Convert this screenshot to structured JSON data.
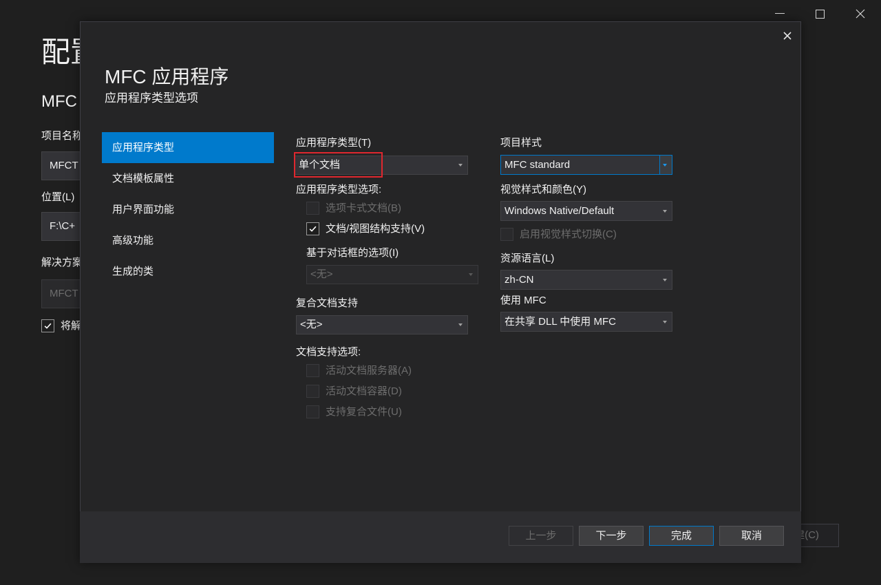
{
  "colors": {
    "window_bg": "#1f1f1f",
    "dialog_bg": "#252526",
    "footer_bg": "#2d2d30",
    "accent": "#007acc",
    "text": "#f1f1f1",
    "text_disabled": "#6d6d6d",
    "highlight": "#e0272e",
    "control_bg": "#333337",
    "control_border": "#434346",
    "disabled_bg": "#2a2a2c",
    "disabled_border": "#3a3a3d",
    "button_bg": "#3f3f41",
    "button_border": "#555558"
  },
  "icons": {
    "window_minimize": "minimize-icon",
    "window_maximize": "maximize-icon",
    "window_close": "close-icon",
    "dialog_close": "close-icon",
    "dropdown": "chevron-down-icon",
    "checkbox_checked": "checkmark-icon"
  },
  "window": {
    "title": "配置",
    "subtitle": "MFC",
    "project_name": {
      "label": "项目名称",
      "value": "MFCT"
    },
    "location": {
      "label": "位置(L)",
      "value": "F:\\C+"
    },
    "solution": {
      "label": "解决方案",
      "value": "MFCT",
      "disabled": true
    },
    "place_in_same_dir": {
      "label": "将解",
      "checked": true,
      "disabled": false
    },
    "create_button": {
      "label": "建(C)",
      "disabled": true
    }
  },
  "dialog": {
    "title": "MFC 应用程序",
    "subtitle": "应用程序类型选项",
    "nav": {
      "selected": 0,
      "items": [
        "应用程序类型",
        "文档模板属性",
        "用户界面功能",
        "高级功能",
        "生成的类"
      ]
    },
    "form": {
      "app_type": {
        "label": "应用程序类型(T)",
        "value": "单个文档",
        "highlighted": true
      },
      "app_type_options": {
        "label": "应用程序类型选项:",
        "tabbed_documents": {
          "label": "选项卡式文档(B)",
          "checked": false,
          "disabled": true
        },
        "doc_view_support": {
          "label": "文档/视图结构支持(V)",
          "checked": true,
          "disabled": false
        }
      },
      "dialog_based_options": {
        "label": "基于对话框的选项(I)",
        "value": "<无>",
        "disabled": true
      },
      "compound_document": {
        "label": "复合文档支持",
        "value": "<无>"
      },
      "document_support": {
        "label": "文档支持选项:",
        "items": [
          {
            "label": "活动文档服务器(A)",
            "checked": false,
            "disabled": true
          },
          {
            "label": "活动文档容器(D)",
            "checked": false,
            "disabled": true
          },
          {
            "label": "支持复合文件(U)",
            "checked": false,
            "disabled": true
          }
        ]
      },
      "project_style": {
        "label": "项目样式",
        "value": "MFC standard",
        "focused": true
      },
      "visual_style": {
        "label": "视觉样式和颜色(Y)",
        "value": "Windows Native/Default"
      },
      "enable_visual_style_switching": {
        "label": "启用视觉样式切换(C)",
        "checked": false,
        "disabled": true
      },
      "resource_language": {
        "label": "资源语言(L)",
        "value": "zh-CN"
      },
      "use_mfc": {
        "label": "使用 MFC",
        "value": "在共享 DLL 中使用 MFC"
      }
    },
    "footer": {
      "back": {
        "label": "上一步",
        "disabled": true
      },
      "next": {
        "label": "下一步",
        "disabled": false
      },
      "finish": {
        "label": "完成",
        "primary": true
      },
      "cancel": {
        "label": "取消"
      }
    }
  }
}
